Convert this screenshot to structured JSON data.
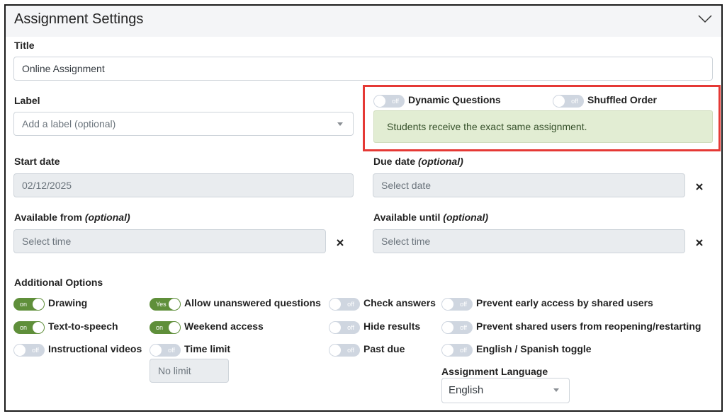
{
  "header": {
    "title": "Assignment Settings"
  },
  "title_field": {
    "label": "Title",
    "value": "Online Assignment"
  },
  "label_field": {
    "label": "Label",
    "placeholder": "Add a label (optional)"
  },
  "dynamic_questions": {
    "label": "Dynamic Questions",
    "state": "off"
  },
  "shuffled_order": {
    "label": "Shuffled Order",
    "state": "off"
  },
  "alert": {
    "text": "Students receive the exact same assignment."
  },
  "start_date": {
    "label": "Start date",
    "value": "02/12/2025"
  },
  "due_date": {
    "label": "Due date",
    "label_optional": "(optional)",
    "placeholder": "Select date"
  },
  "available_from": {
    "label": "Available from",
    "label_optional": "(optional)",
    "placeholder": "Select time"
  },
  "available_until": {
    "label": "Available until",
    "label_optional": "(optional)",
    "placeholder": "Select time"
  },
  "clear_icon": "×",
  "additional_options": {
    "title": "Additional Options",
    "toggles": [
      {
        "label": "Drawing",
        "state": "on"
      },
      {
        "label": "Text-to-speech",
        "state": "on"
      },
      {
        "label": "Instructional videos",
        "state": "off"
      },
      {
        "label": "Allow unanswered questions",
        "state": "Yes"
      },
      {
        "label": "Weekend access",
        "state": "on"
      },
      {
        "label": "Time limit",
        "state": "off"
      },
      {
        "label": "Check answers",
        "state": "off"
      },
      {
        "label": "Hide results",
        "state": "off"
      },
      {
        "label": "Past due",
        "state": "off"
      },
      {
        "label": "Prevent early access by shared users",
        "state": "off"
      },
      {
        "label": "Prevent shared users from reopening/restarting",
        "state": "off"
      },
      {
        "label": "English / Spanish toggle",
        "state": "off"
      }
    ],
    "time_limit_value": "No limit",
    "language": {
      "label": "Assignment Language",
      "value": "English"
    }
  },
  "colors": {
    "highlight": "#e53935",
    "toggle_on": "#5f8f3a",
    "toggle_off": "#cfd6e0",
    "alert_bg": "#e2edd3"
  }
}
